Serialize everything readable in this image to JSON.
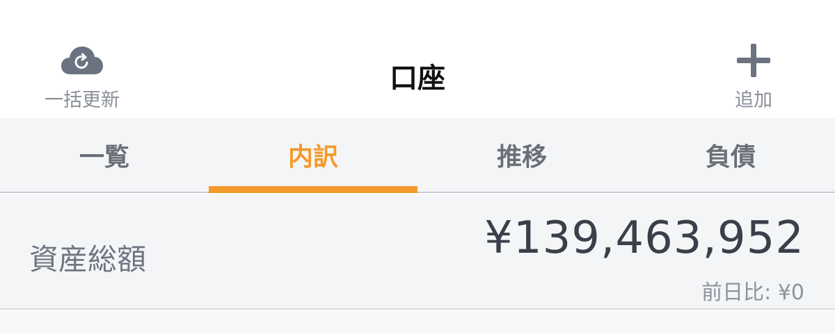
{
  "header": {
    "title": "口座",
    "refresh_label": "一括更新",
    "add_label": "追加"
  },
  "tabs": [
    {
      "label": "一覧",
      "active": false
    },
    {
      "label": "内訳",
      "active": true
    },
    {
      "label": "推移",
      "active": false
    },
    {
      "label": "負債",
      "active": false
    }
  ],
  "summary": {
    "label": "資産総額",
    "total": "¥139,463,952",
    "diff": "前日比: ¥0"
  },
  "colors": {
    "accent": "#f39a2b",
    "icon": "#6b7280",
    "panel_bg": "#f4f5f7"
  },
  "icons": {
    "refresh": "cloud-refresh-icon",
    "add": "plus-icon"
  }
}
